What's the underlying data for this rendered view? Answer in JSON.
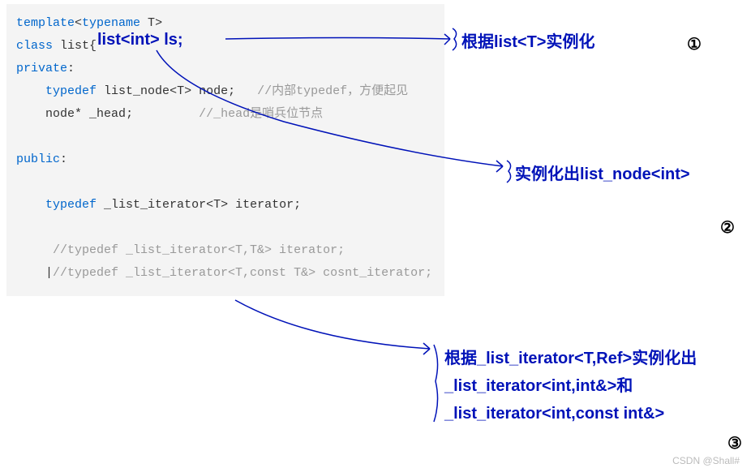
{
  "code": {
    "l1_kw1": "template",
    "l1_punct1": "<",
    "l1_kw2": "typename",
    "l1_ident": " T",
    "l1_punct2": ">",
    "l2_kw": "class",
    "l2_ident": " list",
    "l2_brace": "{",
    "l3_kw": "private",
    "l3_colon": ":",
    "l4_indent": "    ",
    "l4_kw": "typedef",
    "l4_space": " ",
    "l4_type": "list_node",
    "l4_punct1": "<",
    "l4_t": "T",
    "l4_punct2": ">",
    "l4_space2": " ",
    "l4_node": "node",
    "l4_semi": ";",
    "l4_comment": "   //内部typedef，方便起见",
    "l5_indent": "    ",
    "l5_type": "node",
    "l5_ptr": "* ",
    "l5_ident": "_head",
    "l5_semi": ";",
    "l5_space": "         ",
    "l5_comment": "//_head是哨兵位节点",
    "l6_empty": " ",
    "l7_kw": "public",
    "l7_colon": ":",
    "l8_empty": " ",
    "l9_indent": "    ",
    "l9_kw": "typedef",
    "l9_space": " ",
    "l9_type": "_list_iterator",
    "l9_lt": "<",
    "l9_t": "T",
    "l9_gt": ">",
    "l9_space2": " ",
    "l9_iter": "iterator",
    "l9_semi": ";",
    "l10_empty": " ",
    "l11_indent": "     ",
    "l11_comment": "//typedef _list_iterator<T,T&> iterator;",
    "l12_indent": "    |",
    "l12_comment": "//typedef _list_iterator<T,const T&> cosnt_iterator;"
  },
  "annotations": {
    "handwritten": "list<int> ls;",
    "right1": "根据list<T>实例化",
    "right2": "实例化出list_node<int>",
    "right3_line1": "根据_list_iterator<T,Ref>实例化出",
    "right3_line2": "_list_iterator<int,int&>和",
    "right3_line3": "_list_iterator<int,const int&>"
  },
  "nums": {
    "n1": "①",
    "n2": "②",
    "n3": "③"
  },
  "watermark": "CSDN @Shall#"
}
